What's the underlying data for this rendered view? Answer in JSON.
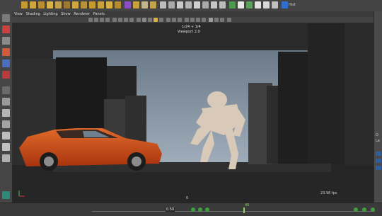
{
  "shelf": {
    "right_label": "Hist"
  },
  "viewport_menu": [
    "View",
    "Shading",
    "Lighting",
    "Show",
    "Renderer",
    "Panels"
  ],
  "viewport": {
    "camera_info_1": "1/24 + 1/4",
    "camera_info_2": "Viewport 2.0",
    "frame_readout": "0",
    "fps_readout": "23.98 fps"
  },
  "right_panel": {
    "labels": [
      "D",
      "La"
    ]
  },
  "timeline": {
    "current_frame": "0.50",
    "marker_label": "45"
  },
  "colors": {
    "sky_top": "#6b7a89",
    "sky_bottom": "#9aa7b5",
    "car": "#c8461a",
    "character": "#d8c9b8"
  }
}
